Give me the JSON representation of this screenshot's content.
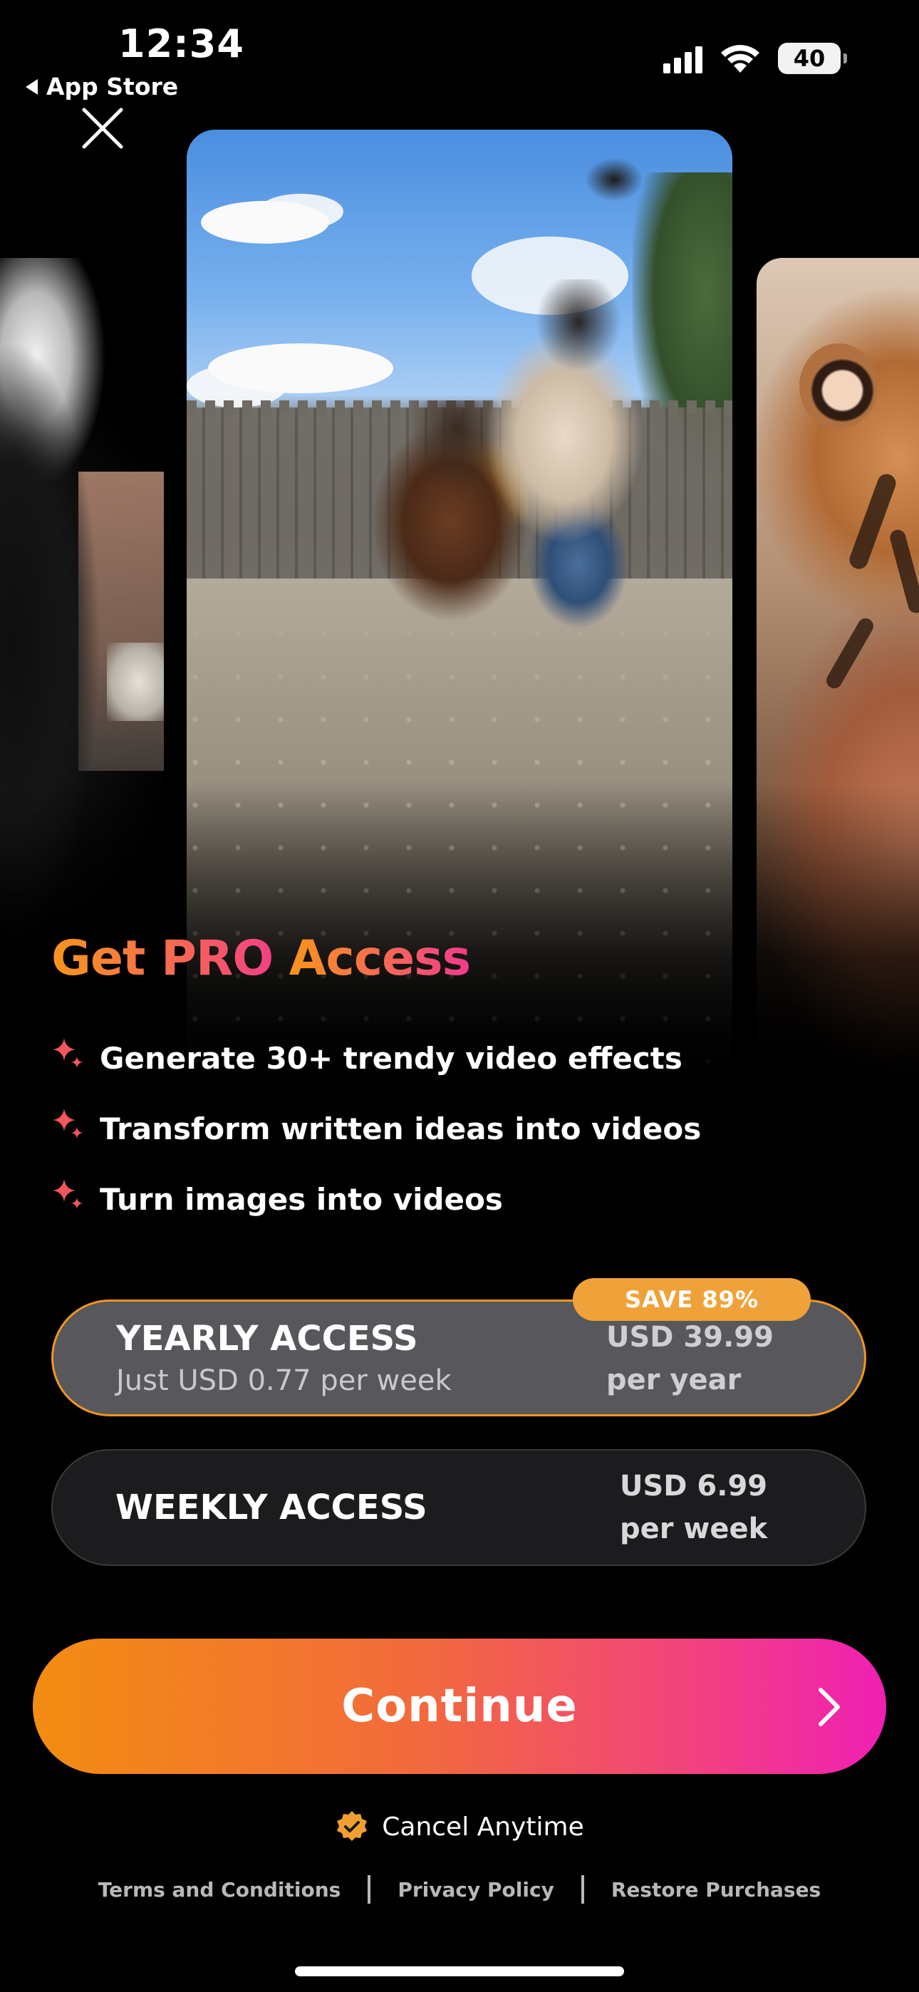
{
  "status_bar": {
    "time": "12:34",
    "back_label": "App Store",
    "battery": "40"
  },
  "icons": {
    "close": "close-icon",
    "sparkle": "sparkle-icon",
    "verified": "verified-badge-icon",
    "chevron": "chevron-right-icon"
  },
  "colors": {
    "accent_orange": "#f7951d",
    "accent_pink": "#f01fb4",
    "selected_border": "#f0961e"
  },
  "headline": {
    "part1": "Get PRO ",
    "part2": "Access"
  },
  "features": [
    "Generate 30+ trendy video effects",
    "Transform written ideas into videos",
    "Turn images into videos"
  ],
  "plans": {
    "yearly": {
      "title": "YEARLY ACCESS",
      "subtitle": "Just USD 0.77 per week",
      "price": "USD 39.99",
      "period": "per year",
      "badge": "SAVE 89%",
      "selected": true
    },
    "weekly": {
      "title": "WEEKLY ACCESS",
      "price": "USD 6.99",
      "period": "per week",
      "selected": false
    }
  },
  "cta": {
    "label": "Continue"
  },
  "footer": {
    "cancel": "Cancel Anytime",
    "terms": "Terms and Conditions",
    "privacy": "Privacy Policy",
    "restore": "Restore Purchases"
  }
}
